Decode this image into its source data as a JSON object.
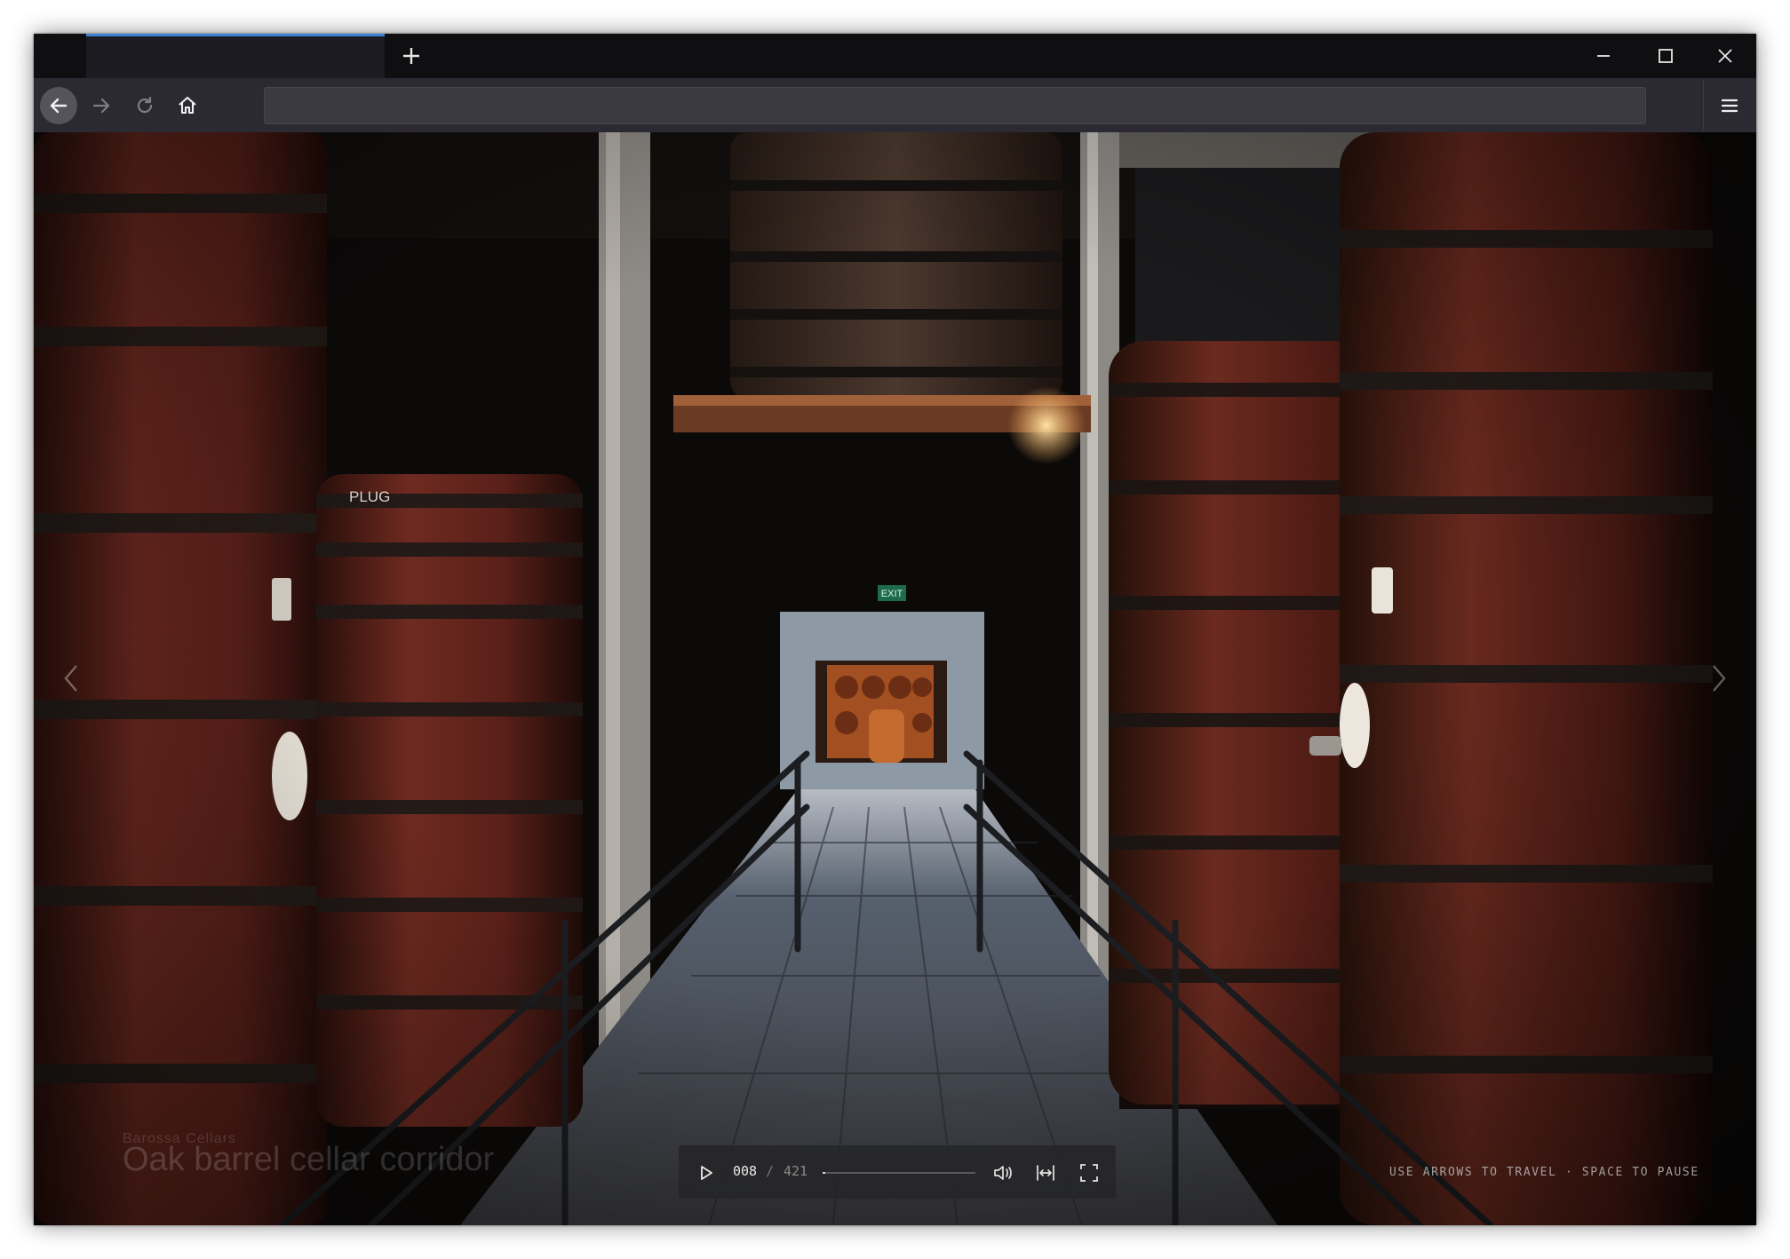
{
  "browser": {
    "tab_title": "",
    "new_tab_icon": "plus-icon",
    "address": "",
    "accent_color": "#3a84d6"
  },
  "viewer": {
    "caption_subtitle": "Barossa Cellars",
    "caption_title": "Oak barrel cellar corridor",
    "exit_sign": "EXIT",
    "barrel_marking": "PLUG",
    "current_frame": "008",
    "frame_separator": "/",
    "total_frames": "421",
    "progress_fraction": 0.019,
    "hint": "USE ARROWS TO TRAVEL · SPACE TO PAUSE"
  }
}
